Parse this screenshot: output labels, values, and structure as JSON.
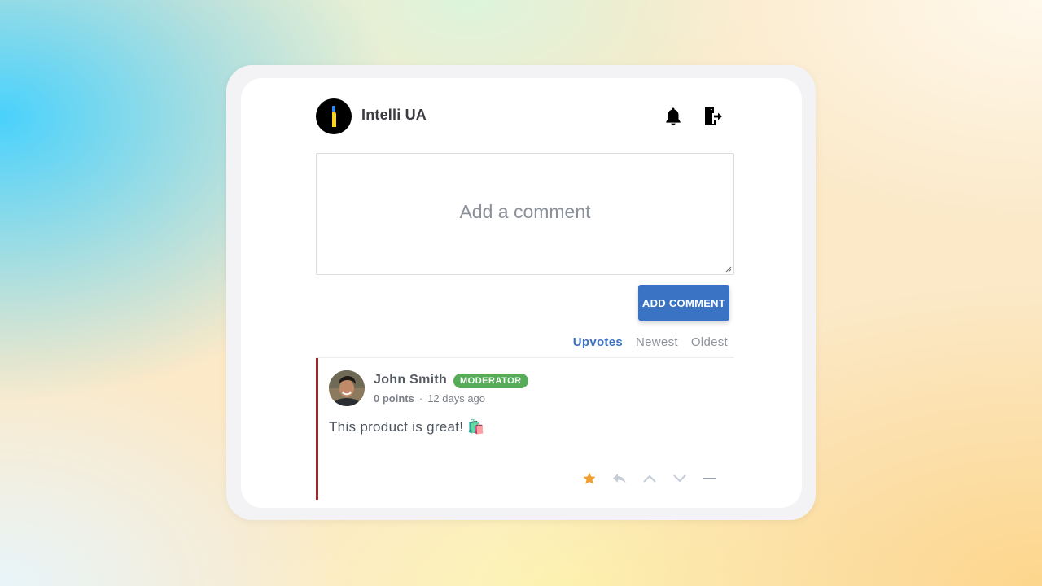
{
  "header": {
    "app_title": "Intelli UA",
    "logo_icon": "intelli-ua-logo",
    "notification_icon": "bell-icon",
    "logout_icon": "logout-door-icon"
  },
  "comment_form": {
    "placeholder": "Add a comment",
    "value": "",
    "submit_label": "ADD COMMENT"
  },
  "sort": {
    "tabs": [
      {
        "label": "Upvotes",
        "active": true
      },
      {
        "label": "Newest",
        "active": false
      },
      {
        "label": "Oldest",
        "active": false
      }
    ]
  },
  "comments": [
    {
      "author": "John Smith",
      "badge": "MODERATOR",
      "points": "0 points",
      "separator": "·",
      "time": "12 days ago",
      "body": "This product is great! 🛍️",
      "actions": [
        "star-icon",
        "reply-icon",
        "upvote-icon",
        "downvote-icon",
        "collapse-icon"
      ]
    }
  ],
  "colors": {
    "accent": "#3a72c4",
    "badge": "#56ad58",
    "comment_border": "#a3262c",
    "star": "#f0a030",
    "action_muted": "#c5ccd6"
  }
}
